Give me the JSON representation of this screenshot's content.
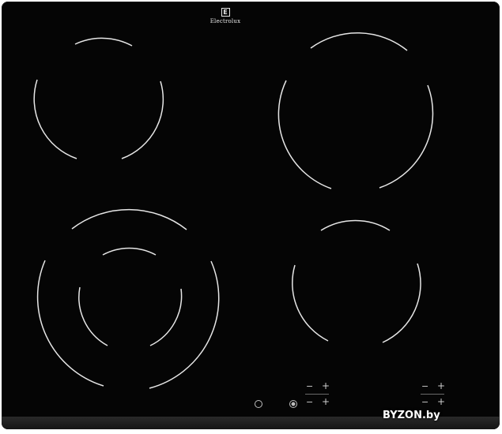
{
  "appliance": {
    "brand": "Electrolux",
    "logo_icon": "electrolux-logo-icon"
  },
  "controls": {
    "left_minus": "−",
    "left_plus": "+",
    "right_minus": "−",
    "right_plus": "+",
    "power_icon": "power-icon",
    "lock_icon": "lock-icon"
  },
  "watermark": "BYZON.by",
  "colors": {
    "surface": "#050505",
    "zone_lines": "#e6e6e6",
    "controls": "#d0d0d0"
  }
}
